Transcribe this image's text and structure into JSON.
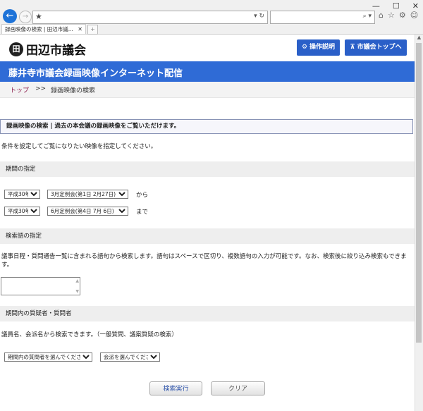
{
  "browser": {
    "window_controls": [
      "—",
      "☐",
      "✕"
    ],
    "tab_title": "録画映像の検索 | 田辺市議...",
    "address_star": "★",
    "address_controls": "▾ ↻",
    "search_controls": "⌕ ▾",
    "icons": [
      "⌂",
      "☆",
      "⚙",
      "☺"
    ]
  },
  "header": {
    "logo_mark": "田",
    "logo_text": "田辺市議会",
    "manual_button": "操作説明",
    "top_button": "市議会トップへ"
  },
  "banner": {
    "title": "藤井寺市議会録画映像インターネット配信"
  },
  "breadcrumb": {
    "home": "トップ",
    "separator": ">>",
    "current": "録画映像の検索"
  },
  "notice": "録画映像の検索 | 過去の本会議の録画映像をご覧いただけます。",
  "intro": "条件を設定してご覧になりたい映像を指定してください。",
  "period": {
    "heading": "期間の指定",
    "from_year": "平成30年",
    "from_session": "3月定例会(第1日 2月27日)",
    "from_label": "から",
    "to_year": "平成30年",
    "to_session": "6月定例会(第4日 7月 6日)",
    "to_label": "まで"
  },
  "keyword": {
    "heading": "検索語の指定",
    "description": "議事日程・質問通告一覧に含まれる語句から検索します。語句はスペースで区切り、複数語句の入力が可能です。なお、検索後に絞り込み検索もできます。",
    "value": ""
  },
  "questioner": {
    "heading": "期間内の質疑者・質問者",
    "description": "議員名、会派名から検索できます。（一般質問、議案質疑の検索）",
    "member_select": "期間内の質問者を選んでください",
    "party_select": "会派を選んでください"
  },
  "actions": {
    "search": "検索実行",
    "clear": "クリア"
  }
}
